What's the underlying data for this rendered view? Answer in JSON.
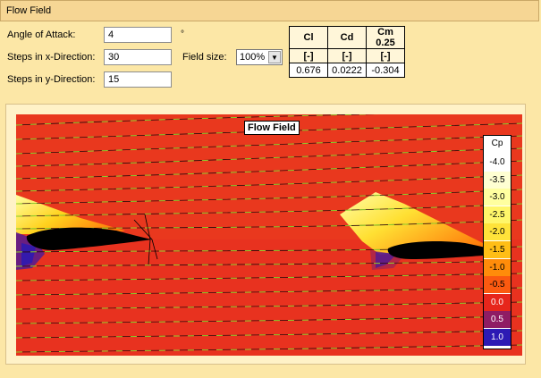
{
  "panel": {
    "title": "Flow Field"
  },
  "inputs": {
    "angle_label": "Angle of Attack:",
    "angle_value": "4",
    "angle_unit": "°",
    "steps_x_label": "Steps in x-Direction:",
    "steps_x_value": "30",
    "steps_y_label": "Steps in y-Direction:",
    "steps_y_value": "15",
    "field_size_label": "Field size:",
    "field_size_value": "100%"
  },
  "coefficients": {
    "headers": [
      "Cl",
      "Cd",
      "Cm 0.25"
    ],
    "units": [
      "[-]",
      "[-]",
      "[-]"
    ],
    "values": [
      "0.676",
      "0.0222",
      "-0.304"
    ]
  },
  "plot": {
    "title": "Flow Field",
    "legend_title": "Cp",
    "legend": [
      {
        "label": "-4.0",
        "color": "#ffffff"
      },
      {
        "label": "-3.5",
        "color": "#ffffd2"
      },
      {
        "label": "-3.0",
        "color": "#ffffa0"
      },
      {
        "label": "-2.5",
        "color": "#fff66a"
      },
      {
        "label": "-2.0",
        "color": "#ffe33a"
      },
      {
        "label": "-1.5",
        "color": "#ffbe16"
      },
      {
        "label": "-1.0",
        "color": "#ff8c0a"
      },
      {
        "label": "-0.5",
        "color": "#fb5a10"
      },
      {
        "label": "0.0",
        "color": "#e7261c"
      },
      {
        "label": "0.5",
        "color": "#8f1c64"
      },
      {
        "label": "1.0",
        "color": "#2c1ab4"
      }
    ],
    "colors": {
      "field": "#e8321f",
      "streamline": "#8fd02c",
      "airfoil": "#000000"
    }
  }
}
